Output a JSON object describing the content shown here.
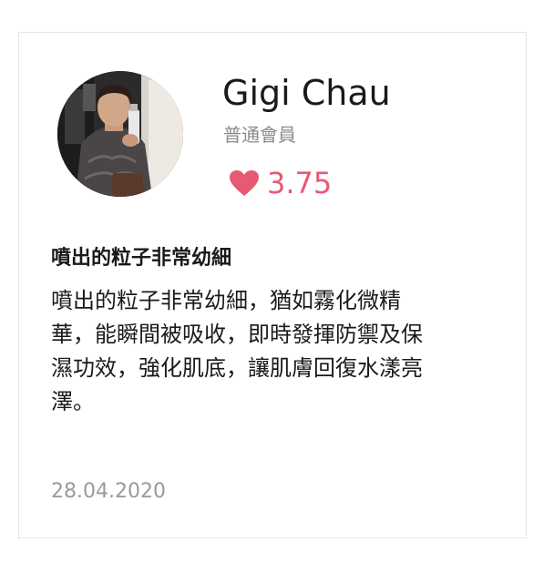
{
  "reviewer": {
    "name": "Gigi Chau",
    "membership": "普通會員",
    "avatar_alt": "reviewer photo"
  },
  "rating": {
    "icon": "heart-icon",
    "value": "3.75",
    "color": "#e65a73"
  },
  "review": {
    "title": "噴出的粒子非常幼細",
    "body_lines": [
      "噴出的粒子非常幼細，猶如霧化微精",
      "華，能瞬間被吸收，即時發揮防禦及保",
      "濕功效，強化肌底，讓肌膚回復水漾亮",
      "澤。"
    ],
    "date": "28.04.2020"
  }
}
